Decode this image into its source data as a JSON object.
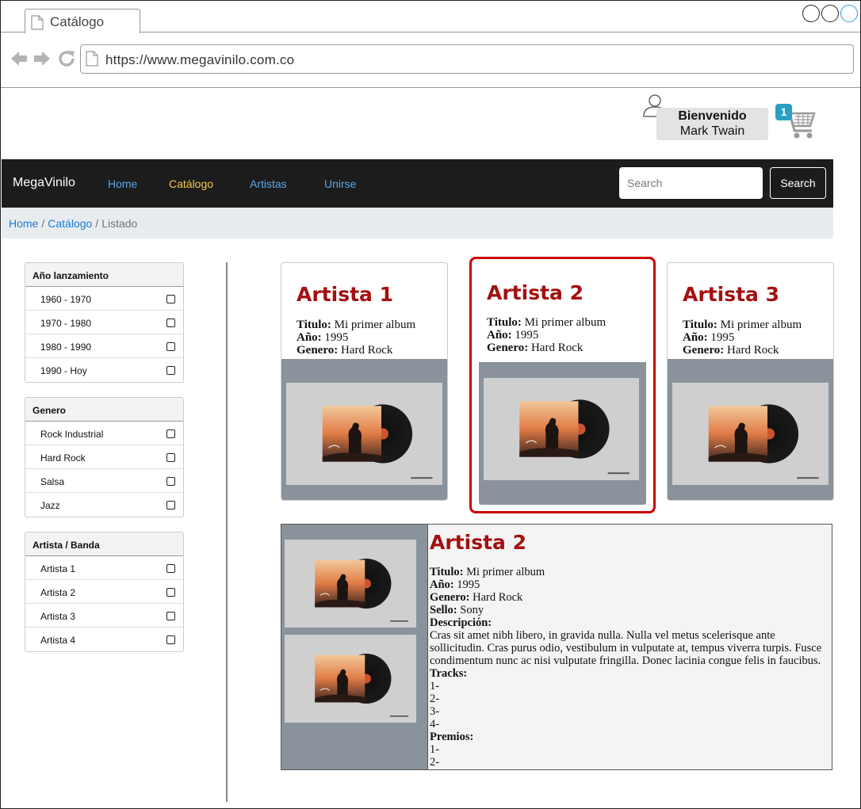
{
  "browser": {
    "tab_title": "Catálogo",
    "url": "https://www.megavinilo.com.co"
  },
  "user": {
    "greeting": "Bienvenido",
    "name": "Mark Twain",
    "cart_count": "1"
  },
  "navbar": {
    "brand": "MegaVinilo",
    "links": [
      {
        "label": "Home",
        "active": false
      },
      {
        "label": "Catálogo",
        "active": true
      },
      {
        "label": "Artistas",
        "active": false
      },
      {
        "label": "Unirse",
        "active": false
      }
    ],
    "search_placeholder": "Search",
    "search_button": "Search"
  },
  "breadcrumb": {
    "items": [
      "Home",
      "Catálogo"
    ],
    "current": "Listado"
  },
  "filters": [
    {
      "title": "Año lanzamiento",
      "items": [
        "1960 - 1970",
        "1970 - 1980",
        "1980 - 1990",
        "1990 - Hoy"
      ]
    },
    {
      "title": "Genero",
      "items": [
        "Rock Industrial",
        "Hard Rock",
        "Salsa",
        "Jazz"
      ]
    },
    {
      "title": "Artista / Banda",
      "items": [
        "Artista 1",
        "Artista 2",
        "Artista 3",
        "Artista 4"
      ]
    }
  ],
  "labels": {
    "titulo": "Titulo:",
    "anio": "Año:",
    "genero": "Genero:",
    "sello": "Sello:",
    "descripcion": "Descripción:",
    "tracks": "Tracks:",
    "premios": "Premios:"
  },
  "cards": [
    {
      "artist": "Artista 1",
      "title": "Mi primer album",
      "year": "1995",
      "genre": "Hard Rock"
    },
    {
      "artist": "Artista 2",
      "title": "Mi primer album",
      "year": "1995",
      "genre": "Hard Rock"
    },
    {
      "artist": "Artista 3",
      "title": "Mi primer album",
      "year": "1995",
      "genre": "Hard Rock"
    }
  ],
  "detail": {
    "artist": "Artista 2",
    "title": "Mi primer album",
    "year": "1995",
    "genre": "Hard Rock",
    "label": "Sony",
    "description": "Cras sit amet nibh libero, in gravida nulla. Nulla vel metus scelerisque ante sollicitudin. Cras purus odio, vestibulum in vulputate at, tempus viverra turpis. Fusce condimentum nunc ac nisi vulputate fringilla. Donec lacinia congue felis in faucibus.",
    "tracks": [
      "1-",
      "2-",
      "3-",
      "4-"
    ],
    "awards": [
      "1-",
      "2-"
    ]
  },
  "colors": {
    "accent_red": "#a31010",
    "selected_border": "#cc0000",
    "nav_link": "#5aa8ec",
    "nav_active": "#f2c94c",
    "cart_badge": "#2a9fc5"
  }
}
